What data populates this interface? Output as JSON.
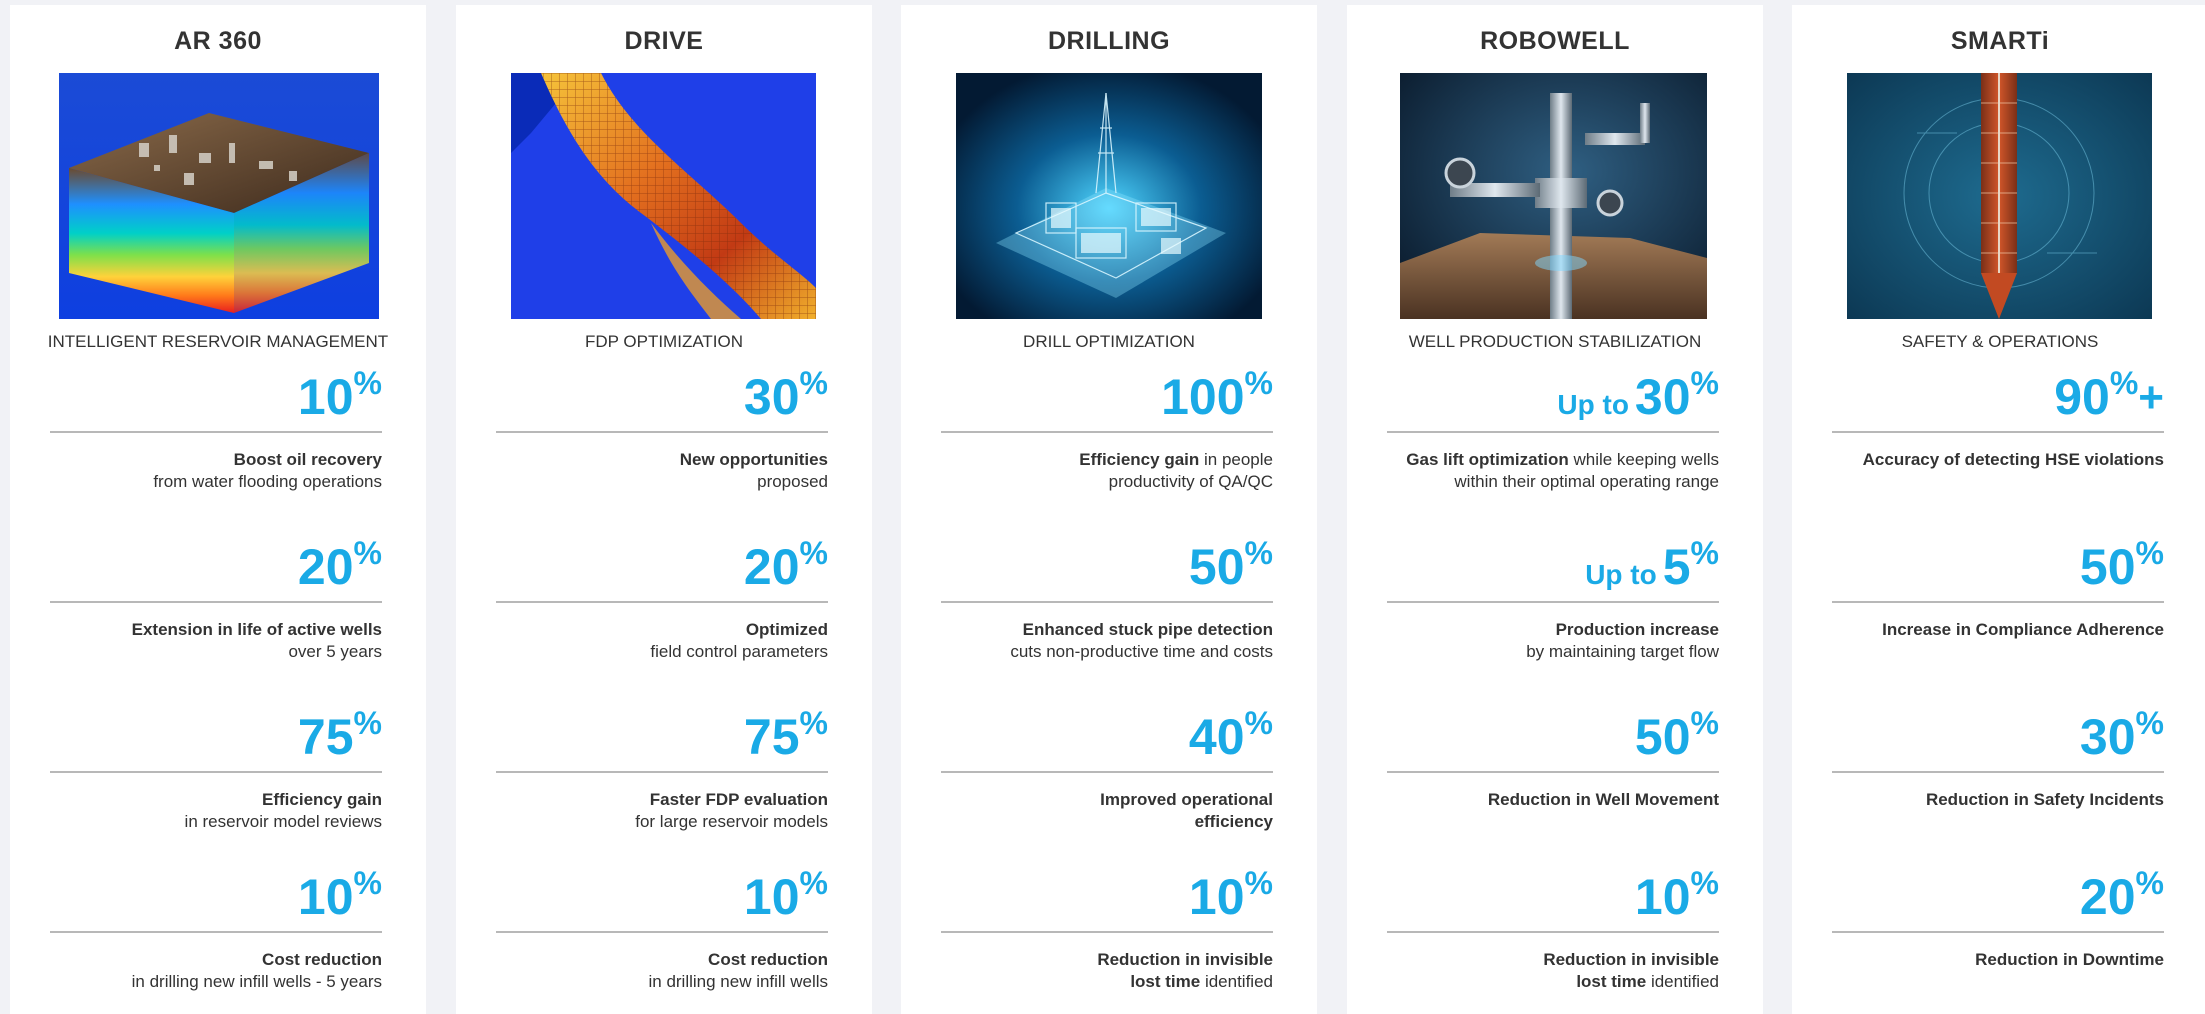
{
  "cards": [
    {
      "title": "AR 360",
      "subtitle": "INTELLIGENT RESERVOIR MANAGEMENT",
      "image": "reservoir-3d-model-image",
      "metrics": [
        {
          "prefix": "",
          "value": "10",
          "unit": "%",
          "suffix": "",
          "bold": "Boost oil recovery",
          "rest": "",
          "line2": "from water flooding operations"
        },
        {
          "prefix": "",
          "value": "20",
          "unit": "%",
          "suffix": "",
          "bold": "Extension in life of active wells",
          "rest": "",
          "line2": "over 5 years"
        },
        {
          "prefix": "",
          "value": "75",
          "unit": "%",
          "suffix": "",
          "bold": "Efficiency gain",
          "rest": "",
          "line2": "in reservoir model reviews"
        },
        {
          "prefix": "",
          "value": "10",
          "unit": "%",
          "suffix": "",
          "bold": "Cost reduction",
          "rest": "",
          "line2": "in drilling new infill wells - 5 years"
        }
      ]
    },
    {
      "title": "DRIVE",
      "subtitle": "FDP OPTIMIZATION",
      "image": "field-surface-map-image",
      "metrics": [
        {
          "prefix": "",
          "value": "30",
          "unit": "%",
          "suffix": "",
          "bold": "New opportunities",
          "rest": "",
          "line2": "proposed"
        },
        {
          "prefix": "",
          "value": "20",
          "unit": "%",
          "suffix": "",
          "bold": "Optimized",
          "rest": "",
          "line2": "field control parameters"
        },
        {
          "prefix": "",
          "value": "75",
          "unit": "%",
          "suffix": "",
          "bold": "Faster FDP evaluation",
          "rest": "",
          "line2": "for large reservoir models"
        },
        {
          "prefix": "",
          "value": "10",
          "unit": "%",
          "suffix": "",
          "bold": "Cost reduction",
          "rest": "",
          "line2": "in drilling new infill wells"
        }
      ]
    },
    {
      "title": "DRILLING",
      "subtitle": "DRILL OPTIMIZATION",
      "image": "digital-rig-hologram-image",
      "metrics": [
        {
          "prefix": "",
          "value": "100",
          "unit": "%",
          "suffix": "",
          "bold": "Efficiency gain",
          "rest": " in people",
          "line2": "productivity of QA/QC"
        },
        {
          "prefix": "",
          "value": "50",
          "unit": "%",
          "suffix": "",
          "bold": "Enhanced stuck pipe detection",
          "rest": "",
          "line2": "cuts non-productive time and costs"
        },
        {
          "prefix": "",
          "value": "40",
          "unit": "%",
          "suffix": "",
          "bold": "Improved operational",
          "rest": "",
          "line2": "",
          "line2bold": "efficiency"
        },
        {
          "prefix": "",
          "value": "10",
          "unit": "%",
          "suffix": "",
          "bold": "Reduction in invisible",
          "rest": "",
          "line2": " identified",
          "line2bold": "lost time"
        }
      ]
    },
    {
      "title": "ROBOWELL",
      "subtitle": "WELL PRODUCTION STABILIZATION",
      "image": "wellhead-valve-image",
      "metrics": [
        {
          "prefix": "Up to",
          "value": "30",
          "unit": "%",
          "suffix": "",
          "bold": "Gas lift optimization",
          "rest": " while keeping wells",
          "line2": "within their optimal operating range"
        },
        {
          "prefix": "Up to",
          "value": "5",
          "unit": "%",
          "suffix": "",
          "bold": "Production increase",
          "rest": "",
          "line2": "by maintaining target flow"
        },
        {
          "prefix": "",
          "value": "50",
          "unit": "%",
          "suffix": "",
          "bold": "Reduction in Well Movement",
          "rest": "",
          "line2": ""
        },
        {
          "prefix": "",
          "value": "10",
          "unit": "%",
          "suffix": "",
          "bold": "Reduction in invisible",
          "rest": "",
          "line2": " identified",
          "line2bold": "lost time"
        }
      ]
    },
    {
      "title": "SMARTi",
      "subtitle": "SAFETY & OPERATIONS",
      "image": "aerial-tanker-ship-image",
      "metrics": [
        {
          "prefix": "",
          "value": "90",
          "unit": "%",
          "suffix": "+",
          "bold": "Accuracy of detecting HSE violations",
          "rest": "",
          "line2": ""
        },
        {
          "prefix": "",
          "value": "50",
          "unit": "%",
          "suffix": "",
          "bold": "Increase in Compliance Adherence",
          "rest": "",
          "line2": ""
        },
        {
          "prefix": "",
          "value": "30",
          "unit": "%",
          "suffix": "",
          "bold": "Reduction in Safety Incidents",
          "rest": "",
          "line2": ""
        },
        {
          "prefix": "",
          "value": "20",
          "unit": "%",
          "suffix": "",
          "bold": "Reduction in Downtime",
          "rest": "",
          "line2": ""
        }
      ]
    }
  ],
  "colors": {
    "accent": "#1aaae6",
    "text": "#333333",
    "rule": "#b8b8b8",
    "background": "#f1f2f6"
  }
}
